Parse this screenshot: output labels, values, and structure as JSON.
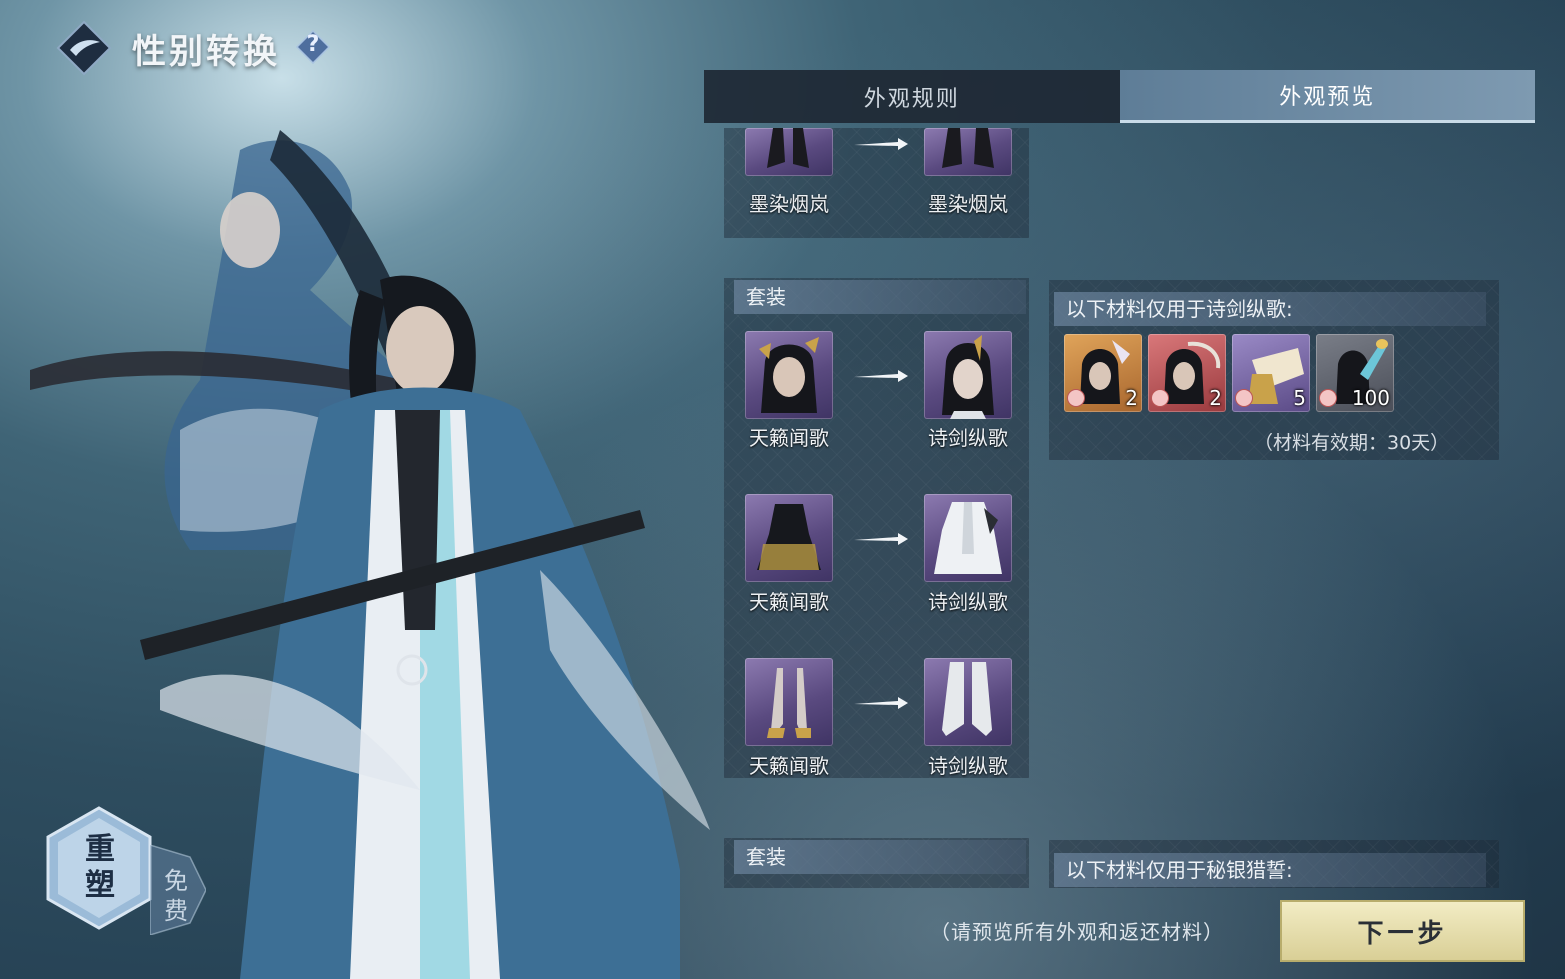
{
  "header": {
    "title": "性别转换",
    "help_label": "?"
  },
  "tabs": [
    {
      "label": "外观规则",
      "active": false
    },
    {
      "label": "外观预览",
      "active": true
    }
  ],
  "preview": {
    "top_row": {
      "from": "墨染烟岚",
      "to": "墨染烟岚"
    },
    "section1": {
      "header": "套装",
      "rows": [
        {
          "from": "天籁闻歌",
          "to": "诗剑纵歌",
          "item": "head"
        },
        {
          "from": "天籁闻歌",
          "to": "诗剑纵歌",
          "item": "robe"
        },
        {
          "from": "天籁闻歌",
          "to": "诗剑纵歌",
          "item": "shoes"
        }
      ],
      "materials_title": "以下材料仅用于诗剑纵歌:",
      "materials": [
        {
          "icon": "hairpin-icon",
          "count": "2",
          "color": "#c8873f"
        },
        {
          "icon": "jade-ring-icon",
          "count": "2",
          "color": "#b9585a"
        },
        {
          "icon": "fan-scroll-icon",
          "count": "5",
          "color": "#7a6aa8"
        },
        {
          "icon": "brush-icon",
          "count": "100",
          "color": "#5a5e68"
        }
      ],
      "validity": "（材料有效期：30天）"
    },
    "section2": {
      "header": "套装",
      "materials_title": "以下材料仅用于秘银猎誓:"
    }
  },
  "footer": {
    "hint": "（请预览所有外观和返还材料）",
    "next_label": "下一步",
    "reshape_label": "重塑",
    "free_label": "免费"
  }
}
